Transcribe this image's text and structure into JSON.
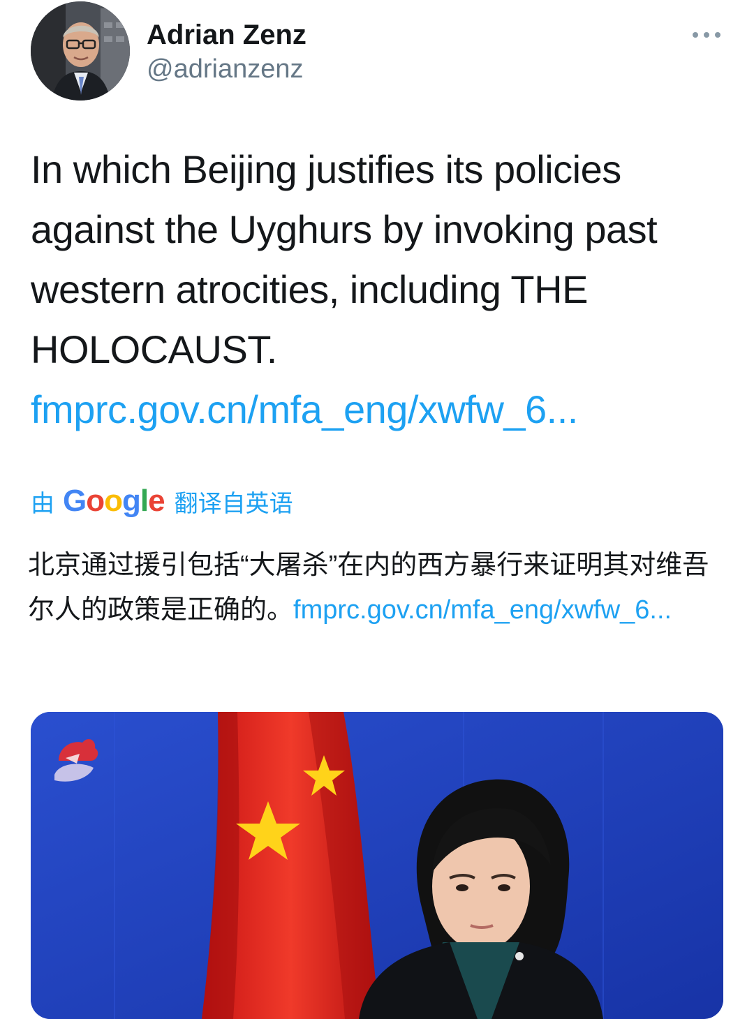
{
  "author": {
    "display_name": "Adrian Zenz",
    "handle": "@adrianzenz",
    "avatar_icon": "profile-photo"
  },
  "menu": {
    "icon": "more-horizontal-icon"
  },
  "tweet": {
    "text": "In which Beijing justifies its policies against the Uyghurs by invoking past western atrocities, including THE HOLOCAUST. ",
    "link_text": "fmprc.gov.cn/mfa_eng/xwfw_6..."
  },
  "translation": {
    "by_label": "由",
    "google_letters": [
      "G",
      "o",
      "o",
      "g",
      "l",
      "e"
    ],
    "translated_from_label": "翻译自英语",
    "text": "北京通过援引包括“大屠杀”在内的西方暴行来证明其对维吾尔人的政策是正确的。",
    "link_text": "fmprc.gov.cn/mfa_eng/xwfw_6..."
  },
  "colors": {
    "link": "#1da1f2",
    "handle": "#657786",
    "text": "#14171a"
  }
}
